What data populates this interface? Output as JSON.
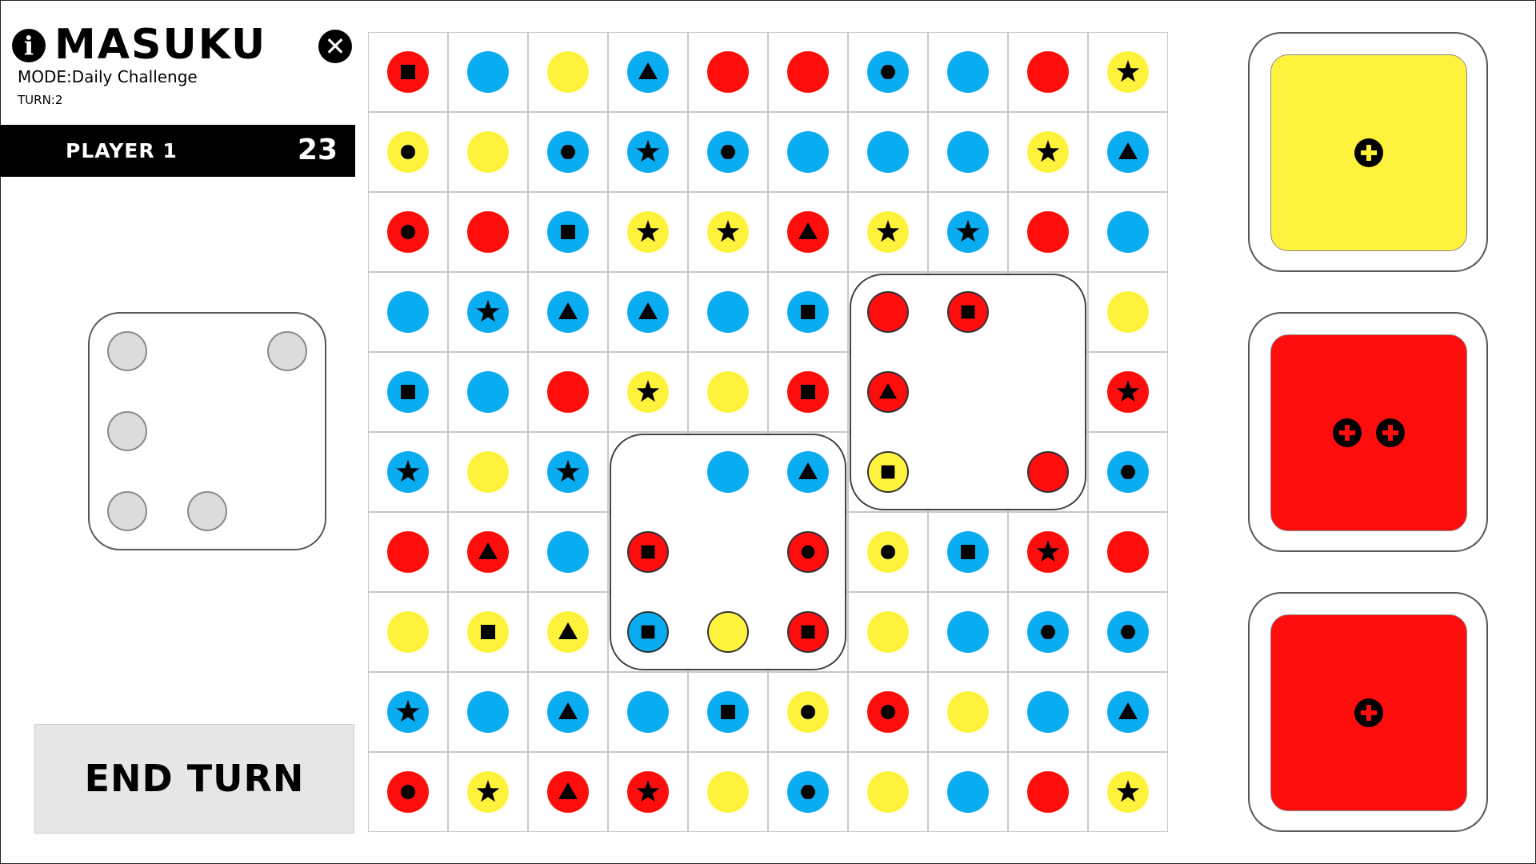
{
  "header": {
    "title": "MASUKU",
    "mode": "MODE:Daily Challenge",
    "turn": "TURN:2",
    "info_icon": "info-icon",
    "close_icon": "close-icon"
  },
  "player": {
    "name": "PLAYER 1",
    "score": "23"
  },
  "end_turn_label": "END TURN",
  "colors": {
    "red": "#ff0d0d",
    "blue": "#09acf0",
    "yellow": "#fff23c",
    "pip": "#dcdcdc"
  },
  "pips": [
    [
      0,
      0
    ],
    [
      2,
      0
    ],
    [
      0,
      1
    ],
    [
      0,
      2
    ],
    [
      1,
      2
    ]
  ],
  "board": [
    [
      [
        "red",
        "square"
      ],
      [
        "blue",
        ""
      ],
      [
        "yellow",
        ""
      ],
      [
        "blue",
        "triangle"
      ],
      [
        "red",
        ""
      ],
      [
        "red",
        ""
      ],
      [
        "blue",
        "circle"
      ],
      [
        "blue",
        ""
      ],
      [
        "red",
        ""
      ],
      [
        "yellow",
        "star"
      ]
    ],
    [
      [
        "yellow",
        "circle"
      ],
      [
        "yellow",
        ""
      ],
      [
        "blue",
        "circle"
      ],
      [
        "blue",
        "star"
      ],
      [
        "blue",
        "circle"
      ],
      [
        "blue",
        ""
      ],
      [
        "blue",
        ""
      ],
      [
        "blue",
        ""
      ],
      [
        "yellow",
        "star"
      ],
      [
        "blue",
        "triangle"
      ]
    ],
    [
      [
        "red",
        "circle"
      ],
      [
        "red",
        ""
      ],
      [
        "blue",
        "square"
      ],
      [
        "yellow",
        "star"
      ],
      [
        "yellow",
        "star"
      ],
      [
        "red",
        "triangle"
      ],
      [
        "yellow",
        "star"
      ],
      [
        "blue",
        "star"
      ],
      [
        "red",
        ""
      ],
      [
        "blue",
        ""
      ]
    ],
    [
      [
        "blue",
        ""
      ],
      [
        "blue",
        "star"
      ],
      [
        "blue",
        "triangle"
      ],
      [
        "blue",
        "triangle"
      ],
      [
        "blue",
        ""
      ],
      [
        "blue",
        "square"
      ],
      [
        "red",
        ""
      ],
      [
        "red",
        "square"
      ],
      null,
      [
        "yellow",
        ""
      ]
    ],
    [
      [
        "blue",
        "square"
      ],
      [
        "blue",
        ""
      ],
      [
        "red",
        ""
      ],
      [
        "yellow",
        "star"
      ],
      [
        "yellow",
        ""
      ],
      [
        "red",
        "square"
      ],
      [
        "red",
        "triangle"
      ],
      null,
      null,
      [
        "red",
        "star"
      ]
    ],
    [
      [
        "blue",
        "star"
      ],
      [
        "yellow",
        ""
      ],
      [
        "blue",
        "star"
      ],
      null,
      [
        "blue",
        ""
      ],
      [
        "blue",
        "triangle"
      ],
      [
        "yellow",
        "square"
      ],
      null,
      [
        "red",
        ""
      ],
      [
        "blue",
        "circle"
      ]
    ],
    [
      [
        "red",
        ""
      ],
      [
        "red",
        "triangle"
      ],
      [
        "blue",
        ""
      ],
      [
        "red",
        "square"
      ],
      null,
      [
        "red",
        "circle"
      ],
      [
        "yellow",
        "circle"
      ],
      [
        "blue",
        "square"
      ],
      [
        "red",
        "star"
      ],
      [
        "red",
        ""
      ]
    ],
    [
      [
        "yellow",
        ""
      ],
      [
        "yellow",
        "square"
      ],
      [
        "yellow",
        "triangle"
      ],
      [
        "blue",
        "square"
      ],
      [
        "yellow",
        ""
      ],
      [
        "red",
        "square"
      ],
      [
        "yellow",
        ""
      ],
      [
        "blue",
        ""
      ],
      [
        "blue",
        "circle"
      ],
      [
        "blue",
        "circle"
      ]
    ],
    [
      [
        "blue",
        "star"
      ],
      [
        "blue",
        ""
      ],
      [
        "blue",
        "triangle"
      ],
      [
        "blue",
        ""
      ],
      [
        "blue",
        "square"
      ],
      [
        "yellow",
        "circle"
      ],
      [
        "red",
        "circle"
      ],
      [
        "yellow",
        ""
      ],
      [
        "blue",
        ""
      ],
      [
        "blue",
        "triangle"
      ]
    ],
    [
      [
        "red",
        "circle"
      ],
      [
        "yellow",
        "star"
      ],
      [
        "red",
        "triangle"
      ],
      [
        "red",
        "star"
      ],
      [
        "yellow",
        ""
      ],
      [
        "blue",
        "circle"
      ],
      [
        "yellow",
        ""
      ],
      [
        "blue",
        ""
      ],
      [
        "red",
        ""
      ],
      [
        "yellow",
        "star"
      ]
    ]
  ],
  "outlined_cells": [
    [
      5,
      6
    ],
    [
      7,
      3
    ],
    [
      7,
      4
    ],
    [
      7,
      5
    ],
    [
      6,
      3
    ],
    [
      6,
      5
    ],
    [
      3,
      6
    ],
    [
      3,
      7
    ],
    [
      4,
      6
    ],
    [
      5,
      8
    ]
  ],
  "placed_dice": [
    {
      "row": 3,
      "col": 6,
      "span": 3
    },
    {
      "row": 5,
      "col": 3,
      "span": 3
    }
  ],
  "dice_cards": [
    {
      "color": "#fff23c",
      "plus_count": 1
    },
    {
      "color": "#ff0d0d",
      "plus_count": 2
    },
    {
      "color": "#ff0d0d",
      "plus_count": 1
    }
  ]
}
